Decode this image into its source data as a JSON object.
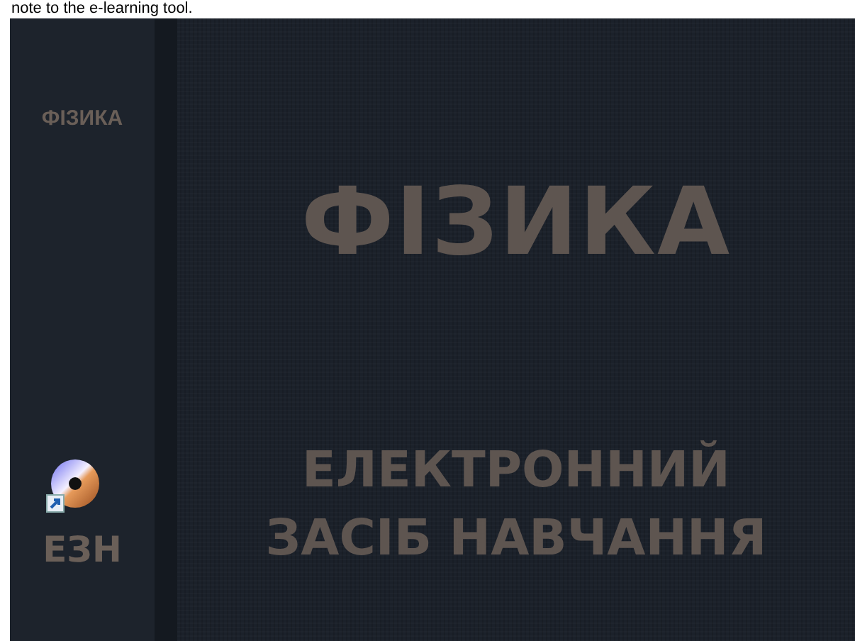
{
  "caption": "note to the e-learning tool.",
  "spine": {
    "title": "ФІЗИКА",
    "abbreviation": "ЕЗН"
  },
  "cover": {
    "title": "ФІЗИКА",
    "subtitle_lines": [
      "ЕЛЕКТРОННИЙ",
      "ЗАСІБ НАВЧАННЯ"
    ]
  },
  "desktop_icons": [
    {
      "kind": "disc-shortcut"
    }
  ]
}
